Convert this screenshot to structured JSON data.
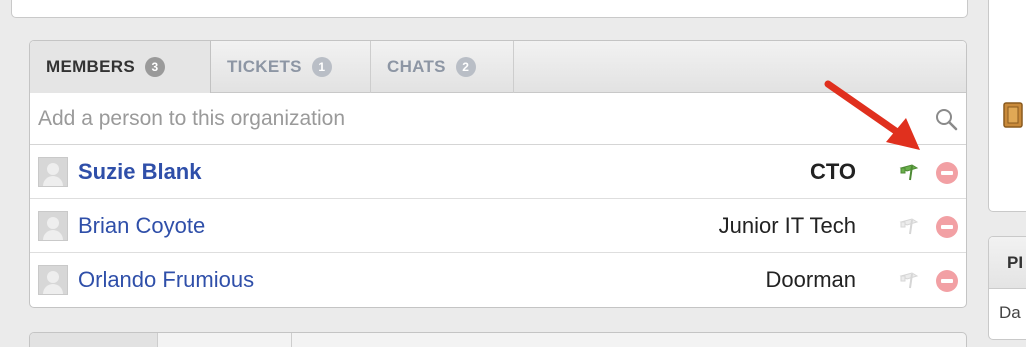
{
  "tabs": [
    {
      "label": "MEMBERS",
      "count": "3",
      "active": true
    },
    {
      "label": "TICKETS",
      "count": "1",
      "active": false
    },
    {
      "label": "CHATS",
      "count": "2",
      "active": false
    }
  ],
  "search": {
    "placeholder": "Add a person to this organization",
    "value": ""
  },
  "members": [
    {
      "name": "Suzie Blank",
      "title": "CTO",
      "primary": true
    },
    {
      "name": "Brian Coyote",
      "title": "Junior IT Tech",
      "primary": false
    },
    {
      "name": "Orlando Frumious",
      "title": "Doorman",
      "primary": false
    }
  ],
  "right_panel": {
    "header": "PI",
    "body": "Da"
  },
  "colors": {
    "link": "#2f4fa9",
    "flag_active": "#6ab04c",
    "flag_inactive": "#e0e0e0",
    "remove": "#f2a0a4",
    "arrow": "#e0301e"
  },
  "icons": {
    "search": "search-icon",
    "flag": "flag-icon",
    "remove": "remove-icon",
    "avatar": "avatar",
    "book": "book-icon"
  }
}
